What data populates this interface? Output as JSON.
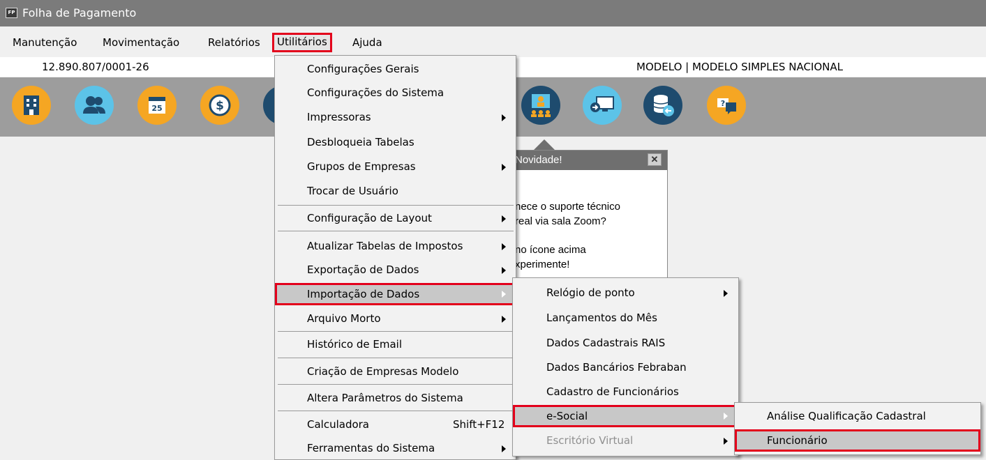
{
  "window": {
    "icon_text": "FP",
    "title": "Folha de Pagamento"
  },
  "menubar": {
    "items": [
      "Manutenção",
      "Movimentação",
      "Relatórios",
      "Utilitários",
      "Ajuda"
    ],
    "active": "Utilitários"
  },
  "infobar": {
    "cnpj": "12.890.807/0001-26",
    "company": "MODELO | MODELO SIMPLES NACIONAL"
  },
  "toolbar": {
    "buttons": [
      "building-icon",
      "users-icon",
      "calendar-icon",
      "money-icon",
      "partially-hidden-icon",
      "video-meeting-icon",
      "remote-screen-icon",
      "database-sync-icon",
      "support-chat-icon"
    ]
  },
  "popup": {
    "title": "Novidade!",
    "close_label": "✕",
    "line1": "nece o suporte técnico",
    "line2": "real via sala Zoom?",
    "line3": "no ícone acima",
    "line4": "xperimente!"
  },
  "utilitarios_menu": {
    "items": [
      {
        "label": "Configurações Gerais"
      },
      {
        "label": "Configurações do Sistema"
      },
      {
        "label": "Impressoras",
        "submenu": true
      },
      {
        "label": "Desbloqueia Tabelas"
      },
      {
        "label": "Grupos de Empresas",
        "submenu": true
      },
      {
        "label": "Trocar de Usuário"
      },
      {
        "label": "Configuração de Layout",
        "submenu": true
      },
      {
        "label": "Atualizar Tabelas de Impostos",
        "submenu": true
      },
      {
        "label": "Exportação de Dados",
        "submenu": true
      },
      {
        "label": "Importação de Dados",
        "submenu": true,
        "highlighted": true
      },
      {
        "label": "Arquivo Morto",
        "submenu": true
      },
      {
        "label": "Histórico de Email"
      },
      {
        "label": "Criação de Empresas Modelo"
      },
      {
        "label": "Altera Parâmetros do Sistema"
      },
      {
        "label": "Calculadora",
        "shortcut": "Shift+F12"
      },
      {
        "label": "Ferramentas do Sistema",
        "submenu": true
      }
    ]
  },
  "importacao_menu": {
    "items": [
      {
        "label": "Relógio de ponto",
        "submenu": true
      },
      {
        "label": "Lançamentos do Mês"
      },
      {
        "label": "Dados Cadastrais RAIS"
      },
      {
        "label": "Dados Bancários Febraban"
      },
      {
        "label": "Cadastro de Funcionários"
      },
      {
        "label": "e-Social",
        "submenu": true,
        "highlighted": true
      },
      {
        "label": "Escritório Virtual",
        "submenu": true,
        "disabled": true
      }
    ]
  },
  "esocial_menu": {
    "items": [
      {
        "label": "Análise Qualificação Cadastral"
      },
      {
        "label": "Funcionário",
        "highlighted": true
      }
    ]
  },
  "colors": {
    "titlebar": "#7b7b7b",
    "toolbar": "#9d9d9d",
    "highlight_border": "#e3001b",
    "highlight_fill": "#c8c8c8",
    "icon_orange": "#f5a623",
    "icon_lightblue": "#5cc3e8",
    "icon_navy": "#1e4b6e"
  }
}
